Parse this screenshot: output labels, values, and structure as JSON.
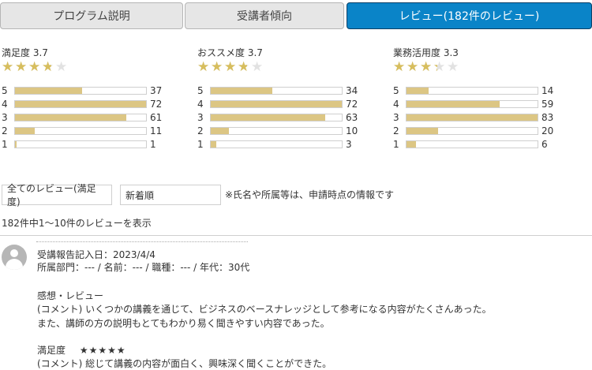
{
  "tabs": [
    {
      "label": "プログラム説明",
      "active": false
    },
    {
      "label": "受講者傾向",
      "active": false
    },
    {
      "label": "レビュー(182件のレビュー)",
      "active": true
    }
  ],
  "colors": {
    "accent": "#0a84c8",
    "star_filled": "#d7be5e",
    "star_empty": "#e2e2e2",
    "bar_fill": "#dcc684"
  },
  "ratings": [
    {
      "title": "満足度 3.7",
      "score": 3.7,
      "rows": [
        {
          "label": "5",
          "count": "37"
        },
        {
          "label": "4",
          "count": "72"
        },
        {
          "label": "3",
          "count": "61"
        },
        {
          "label": "2",
          "count": "11"
        },
        {
          "label": "1",
          "count": "1"
        }
      ]
    },
    {
      "title": "おススメ度 3.7",
      "score": 3.7,
      "rows": [
        {
          "label": "5",
          "count": "34"
        },
        {
          "label": "4",
          "count": "72"
        },
        {
          "label": "3",
          "count": "63"
        },
        {
          "label": "2",
          "count": "10"
        },
        {
          "label": "1",
          "count": "3"
        }
      ]
    },
    {
      "title": "業務活用度 3.3",
      "score": 3.3,
      "rows": [
        {
          "label": "5",
          "count": "14"
        },
        {
          "label": "4",
          "count": "59"
        },
        {
          "label": "3",
          "count": "83"
        },
        {
          "label": "2",
          "count": "20"
        },
        {
          "label": "1",
          "count": "6"
        }
      ]
    }
  ],
  "filters": {
    "review_filter": "全てのレビュー(満足度)",
    "sort": "新着順",
    "note": "※氏名や所属等は、申請時点の情報です"
  },
  "summary": "182件中1〜10件のレビューを表示",
  "review": {
    "date": "受講報告記入日：2023/4/4",
    "meta": "所属部門：--- / 名前：--- / 職種：--- / 年代：30代",
    "section_label": "感想・レビュー",
    "comment1": "(コメント) いくつかの講義を通じて、ビジネスのベースナレッジとして参考になる内容がたくさんあった。",
    "comment2": "また、講師の方の説明もとてもわかり易く聞きやすい内容であった。",
    "satisfaction_label": "満足度",
    "satisfaction_stars": "★★★★★",
    "comment3": "(コメント) 総じて講義の内容が面白く、興味深く聞くことができた。"
  }
}
